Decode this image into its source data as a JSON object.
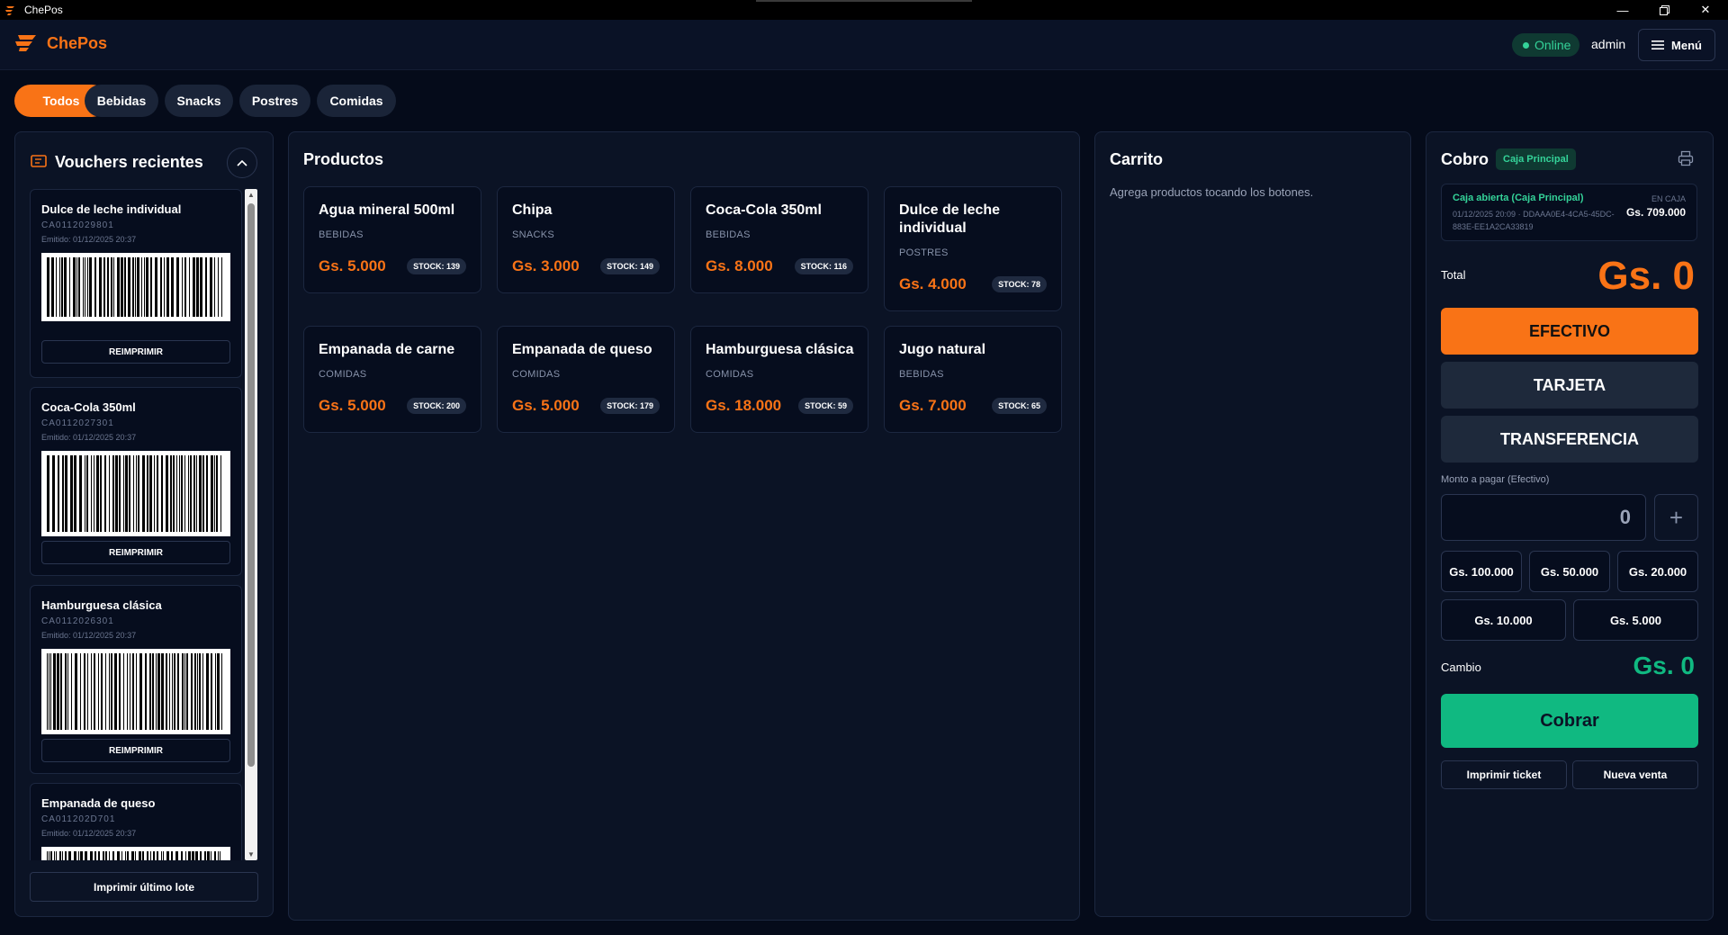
{
  "window": {
    "title": "ChePos"
  },
  "header": {
    "brand": "ChePos",
    "status": "Online",
    "user": "admin",
    "menu_label": "Menú"
  },
  "categories": [
    "Todos",
    "Bebidas",
    "Snacks",
    "Postres",
    "Comidas"
  ],
  "vouchers": {
    "title": "Vouchers recientes",
    "reprint_label": "REIMPRIMIR",
    "print_last_label": "Imprimir último lote",
    "items": [
      {
        "name": "Dulce de leche individual",
        "code": "CA0112029801",
        "issued": "Emitido: 01/12/2025 20:37"
      },
      {
        "name": "Coca-Cola 350ml",
        "code": "CA0112027301",
        "issued": "Emitido: 01/12/2025 20:37"
      },
      {
        "name": "Hamburguesa clásica",
        "code": "CA0112026301",
        "issued": "Emitido: 01/12/2025 20:37"
      },
      {
        "name": "Empanada de queso",
        "code": "CA011202D701",
        "issued": "Emitido: 01/12/2025 20:37"
      }
    ]
  },
  "products": {
    "title": "Productos",
    "items": [
      {
        "name": "Agua mineral 500ml",
        "category": "BEBIDAS",
        "price": "Gs. 5.000",
        "stock": "STOCK: 139"
      },
      {
        "name": "Chipa",
        "category": "SNACKS",
        "price": "Gs. 3.000",
        "stock": "STOCK: 149"
      },
      {
        "name": "Coca-Cola 350ml",
        "category": "BEBIDAS",
        "price": "Gs. 8.000",
        "stock": "STOCK: 116"
      },
      {
        "name": "Dulce de leche individual",
        "category": "POSTRES",
        "price": "Gs. 4.000",
        "stock": "STOCK: 78"
      },
      {
        "name": "Empanada de carne",
        "category": "COMIDAS",
        "price": "Gs. 5.000",
        "stock": "STOCK: 200"
      },
      {
        "name": "Empanada de queso",
        "category": "COMIDAS",
        "price": "Gs. 5.000",
        "stock": "STOCK: 179"
      },
      {
        "name": "Hamburguesa clásica",
        "category": "COMIDAS",
        "price": "Gs. 18.000",
        "stock": "STOCK: 59"
      },
      {
        "name": "Jugo natural",
        "category": "BEBIDAS",
        "price": "Gs. 7.000",
        "stock": "STOCK: 65"
      }
    ]
  },
  "cart": {
    "title": "Carrito",
    "empty_message": "Agrega productos tocando los botones."
  },
  "cobro": {
    "title": "Cobro",
    "caja_badge": "Caja Principal",
    "caja_status": "Caja abierta (Caja Principal)",
    "caja_detail": "01/12/2025 20:09 · DDAAA0E4-4CA5-45DC-883E-EE1A2CA33819",
    "en_caja_label": "EN CAJA",
    "en_caja_amount": "Gs. 709.000",
    "total_label": "Total",
    "total_value": "Gs. 0",
    "methods": [
      "EFECTIVO",
      "TARJETA",
      "TRANSFERENCIA"
    ],
    "active_method": "EFECTIVO",
    "monto_label": "Monto a pagar (Efectivo)",
    "monto_value": "0",
    "quick_amounts": [
      "Gs. 100.000",
      "Gs. 50.000",
      "Gs. 20.000",
      "Gs. 10.000",
      "Gs. 5.000"
    ],
    "cambio_label": "Cambio",
    "cambio_value": "Gs. 0",
    "cobrar_label": "Cobrar",
    "print_ticket_label": "Imprimir ticket",
    "new_sale_label": "Nueva venta"
  },
  "colors": {
    "accent": "#f97316",
    "success": "#10b981",
    "background": "#050b1a",
    "panel": "#0b1325"
  }
}
